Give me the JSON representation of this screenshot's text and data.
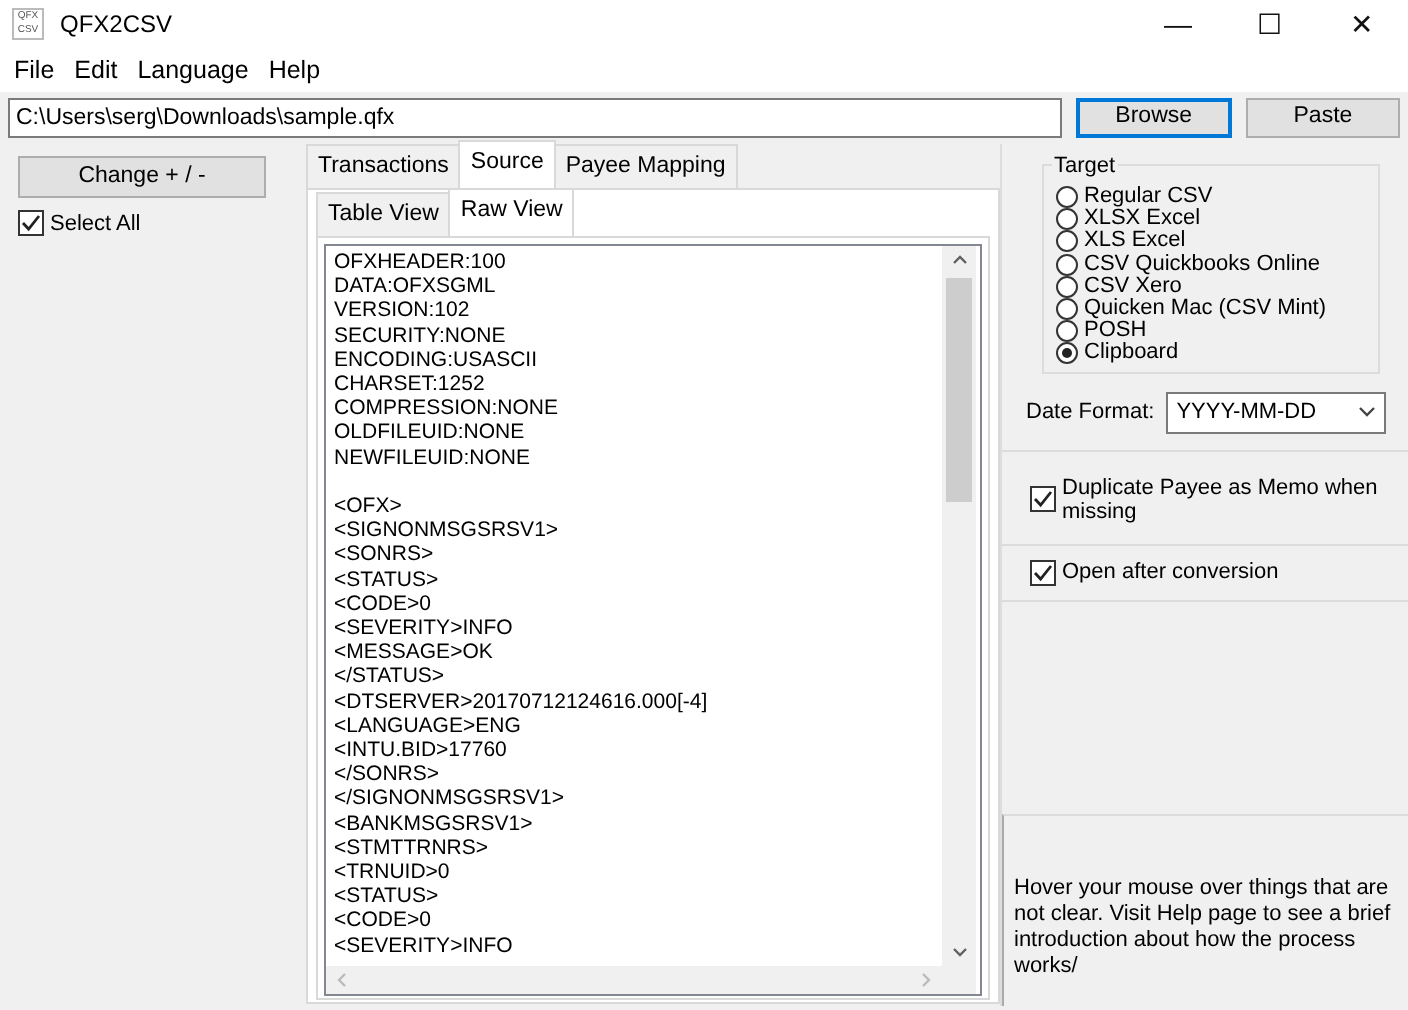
{
  "window": {
    "title": "QFX2CSV",
    "app_icon_text": [
      "QFX",
      "CSV"
    ],
    "controls": [
      "—",
      "☐",
      "✕"
    ]
  },
  "menu": [
    "File",
    "Edit",
    "Language",
    "Help"
  ],
  "path": {
    "value": "C:\\Users\\serg\\Downloads\\sample.qfx"
  },
  "path_buttons": [
    {
      "label": "Browse",
      "focused": true
    },
    {
      "label": "Paste",
      "focused": false
    }
  ],
  "left": {
    "change_button": "Change + / -",
    "select_all": {
      "label": "Select All",
      "checked": true
    }
  },
  "tabs": [
    {
      "label": "Transactions",
      "selected": false
    },
    {
      "label": "Source",
      "selected": true
    },
    {
      "label": "Payee Mapping",
      "selected": false
    }
  ],
  "subtabs": [
    {
      "label": "Table View",
      "selected": false
    },
    {
      "label": "Raw View",
      "selected": true
    }
  ],
  "raw_text": {
    "header_lines": [
      "OFXHEADER:100",
      "DATA:OFXSGML",
      "VERSION:102",
      "SECURITY:NONE",
      "ENCODING:USASCII",
      "CHARSET:1252",
      "COMPRESSION:NONE",
      "OLDFILEUID:NONE",
      "NEWFILEUID:NONE"
    ],
    "body_lines": [
      "<OFX>",
      "<SIGNONMSGSRSV1>",
      "<SONRS>",
      "<STATUS>",
      "<CODE>0",
      "<SEVERITY>INFO",
      "<MESSAGE>OK",
      "</STATUS>",
      "<DTSERVER>20170712124616.000[-4]",
      "<LANGUAGE>ENG",
      "<INTU.BID>17760",
      "</SONRS>",
      "</SIGNONMSGSRSV1>",
      "<BANKMSGSRSV1>",
      "<STMTTRNRS>",
      "<TRNUID>0",
      "<STATUS>",
      "<CODE>0",
      "<SEVERITY>INFO"
    ]
  },
  "target": {
    "title": "Target",
    "options": [
      {
        "label": "Regular CSV",
        "selected": false
      },
      {
        "label": "XLSX Excel",
        "selected": false
      },
      {
        "label": "XLS Excel",
        "selected": false
      },
      {
        "label": "CSV Quickbooks Online",
        "selected": false
      },
      {
        "label": "CSV Xero",
        "selected": false
      },
      {
        "label": "Quicken Mac (CSV Mint)",
        "selected": false
      },
      {
        "label": "POSH",
        "selected": false
      },
      {
        "label": "Clipboard",
        "selected": true
      }
    ]
  },
  "date_format": {
    "label": "Date Format:",
    "value": "YYYY-MM-DD"
  },
  "options": [
    {
      "label": "Duplicate Payee as Memo when missing",
      "checked": true
    },
    {
      "label": "Open after conversion",
      "checked": true
    }
  ],
  "help_text": "Hover your mouse over things that are not clear. Visit Help page to see a brief introduction about how the process works/"
}
